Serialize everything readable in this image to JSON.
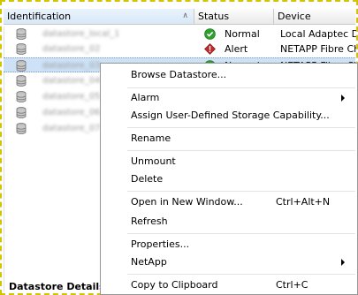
{
  "table": {
    "columns": {
      "identification": "Identification",
      "status": "Status",
      "device": "Device"
    },
    "rows": [
      {
        "name": "datastore_local_1",
        "status": "Normal",
        "status_kind": "ok",
        "device": "Local Adaptec Di"
      },
      {
        "name": "datastore_02",
        "status": "Alert",
        "status_kind": "alert",
        "device": "NETAPP Fibre Cha"
      },
      {
        "name": "datastore_03",
        "status": "Normal",
        "status_kind": "ok",
        "device": "NETAPP Fibre Cha"
      },
      {
        "name": "datastore_04",
        "status": "",
        "status_kind": "",
        "device": ""
      },
      {
        "name": "datastore_05",
        "status": "",
        "status_kind": "",
        "device": ""
      },
      {
        "name": "datastore_06",
        "status": "",
        "status_kind": "",
        "device": ""
      },
      {
        "name": "datastore_07",
        "status": "",
        "status_kind": "",
        "device": ""
      }
    ]
  },
  "panel": {
    "bottom_label": "Datastore Details"
  },
  "context_menu": {
    "items": [
      {
        "label": "Browse Datastore...",
        "shortcut": "",
        "submenu": false
      },
      {
        "label": "Alarm",
        "shortcut": "",
        "submenu": true
      },
      {
        "label": "Assign User-Defined Storage Capability...",
        "shortcut": "",
        "submenu": false
      },
      {
        "label": "Rename",
        "shortcut": "",
        "submenu": false
      },
      {
        "label": "Unmount",
        "shortcut": "",
        "submenu": false
      },
      {
        "label": "Delete",
        "shortcut": "",
        "submenu": false
      },
      {
        "label": "Open in New Window...",
        "shortcut": "Ctrl+Alt+N",
        "submenu": false
      },
      {
        "label": "Refresh",
        "shortcut": "",
        "submenu": false
      },
      {
        "label": "Properties...",
        "shortcut": "",
        "submenu": false
      },
      {
        "label": "NetApp",
        "shortcut": "",
        "submenu": true
      },
      {
        "label": "Copy to Clipboard",
        "shortcut": "Ctrl+C",
        "submenu": false
      }
    ]
  },
  "colors": {
    "selection": "#cde2f7",
    "status_ok": "#2e9e2e",
    "status_alert": "#c0282d",
    "frame_border": "#d4c400"
  },
  "icons": {
    "datastore": "database-icon",
    "ok": "check-circle-icon",
    "alert": "alert-diamond-icon",
    "submenu": "chevron-right-icon"
  }
}
